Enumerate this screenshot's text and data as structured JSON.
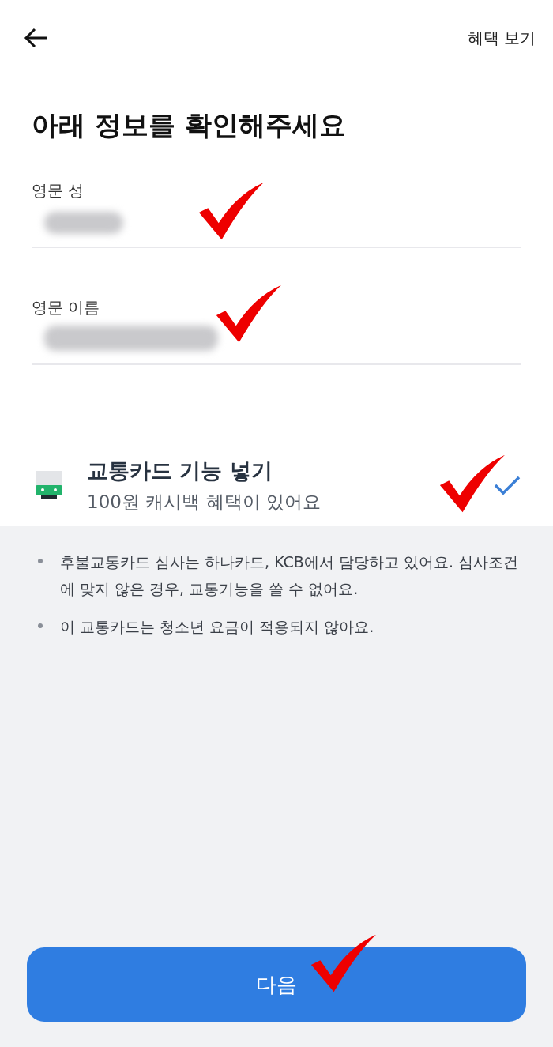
{
  "header": {
    "action": "혜택 보기"
  },
  "title": "아래 정보를 확인해주세요",
  "fields": [
    {
      "label": "영문 성"
    },
    {
      "label": "영문 이름"
    }
  ],
  "option": {
    "title": "교통카드 기능 넣기",
    "subtitle": "100원 캐시백 혜택이 있어요",
    "checked": true
  },
  "notes": [
    "후불교통카드 심사는 하나카드, KCB에서 담당하고 있어요. 심사조건에 맞지 않은 경우, 교통기능을 쓸 수 없어요.",
    "이 교통카드는 청소년 요금이 적용되지 않아요."
  ],
  "button": {
    "label": "다음"
  }
}
